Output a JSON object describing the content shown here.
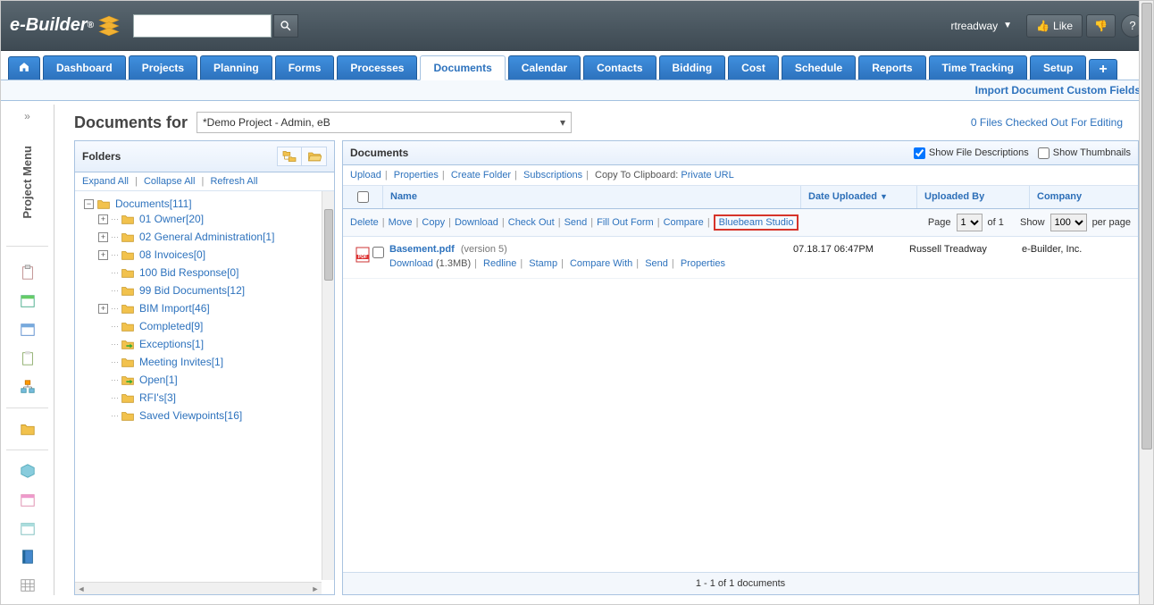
{
  "header": {
    "brand_e": "e",
    "brand_rest": "-Builder",
    "brand_trademark": "®",
    "search_placeholder": "",
    "username": "rtreadway",
    "like_label": "Like",
    "help_label": "?"
  },
  "nav": {
    "tabs": [
      "Dashboard",
      "Projects",
      "Planning",
      "Forms",
      "Processes",
      "Documents",
      "Calendar",
      "Contacts",
      "Bidding",
      "Cost",
      "Schedule",
      "Reports",
      "Time Tracking",
      "Setup"
    ],
    "active": "Documents",
    "import_link": "Import Document Custom Fields"
  },
  "sidebar": {
    "collapse_glyph": "»",
    "label": "Project Menu"
  },
  "page": {
    "title": "Documents for",
    "project": "*Demo Project - Admin, eB",
    "checked_out": "0 Files Checked Out For Editing"
  },
  "folders": {
    "header": "Folders",
    "expand_all": "Expand All",
    "collapse_all": "Collapse All",
    "refresh_all": "Refresh All",
    "tree": [
      {
        "toggle": "-",
        "label": "Documents",
        "count": "[111]",
        "children": [
          {
            "toggle": "+",
            "label": "01 Owner",
            "count": "[20]"
          },
          {
            "toggle": "+",
            "label": "02 General Administration",
            "count": "[1]"
          },
          {
            "toggle": "+",
            "label": "08 Invoices",
            "count": "[0]"
          },
          {
            "toggle": "",
            "label": "100 Bid Response",
            "count": "[0]"
          },
          {
            "toggle": "",
            "label": "99 Bid Documents",
            "count": "[12]"
          },
          {
            "toggle": "+",
            "label": "BIM Import",
            "count": "[46]"
          },
          {
            "toggle": "",
            "label": "Completed",
            "count": "[9]"
          },
          {
            "toggle": "",
            "label": "Exceptions",
            "count": "[1]",
            "special": "green"
          },
          {
            "toggle": "",
            "label": "Meeting Invites",
            "count": "[1]"
          },
          {
            "toggle": "",
            "label": "Open",
            "count": "[1]",
            "special": "green"
          },
          {
            "toggle": "",
            "label": "RFI's",
            "count": "[3]"
          },
          {
            "toggle": "",
            "label": "Saved Viewpoints",
            "count": "[16]"
          }
        ]
      }
    ]
  },
  "documents": {
    "header": "Documents",
    "show_desc": "Show File Descriptions",
    "show_thumb": "Show Thumbnails",
    "show_desc_checked": true,
    "show_thumb_checked": false,
    "toolbar": {
      "upload": "Upload",
      "properties": "Properties",
      "create_folder": "Create Folder",
      "subscriptions": "Subscriptions",
      "copy_clip": "Copy To Clipboard:",
      "private_url": "Private URL"
    },
    "columns": {
      "name": "Name",
      "date": "Date Uploaded",
      "by": "Uploaded By",
      "company": "Company"
    },
    "actions": {
      "delete": "Delete",
      "move": "Move",
      "copy": "Copy",
      "download": "Download",
      "checkout": "Check Out",
      "send": "Send",
      "fillout": "Fill Out Form",
      "compare": "Compare",
      "bluebeam": "Bluebeam Studio"
    },
    "pager": {
      "page": "Page",
      "page_val": "1",
      "of": "of 1",
      "show": "Show",
      "per": "per page",
      "count": "100"
    },
    "rows": [
      {
        "filename": "Basement.pdf",
        "version": "(version 5)",
        "size": "(1.3MB)",
        "date": "07.18.17 06:47PM",
        "by": "Russell Treadway",
        "company": "e-Builder, Inc.",
        "sub": {
          "download": "Download",
          "redline": "Redline",
          "stamp": "Stamp",
          "compare": "Compare With",
          "send": "Send",
          "properties": "Properties"
        }
      }
    ],
    "footer": "1 - 1 of 1 documents"
  }
}
